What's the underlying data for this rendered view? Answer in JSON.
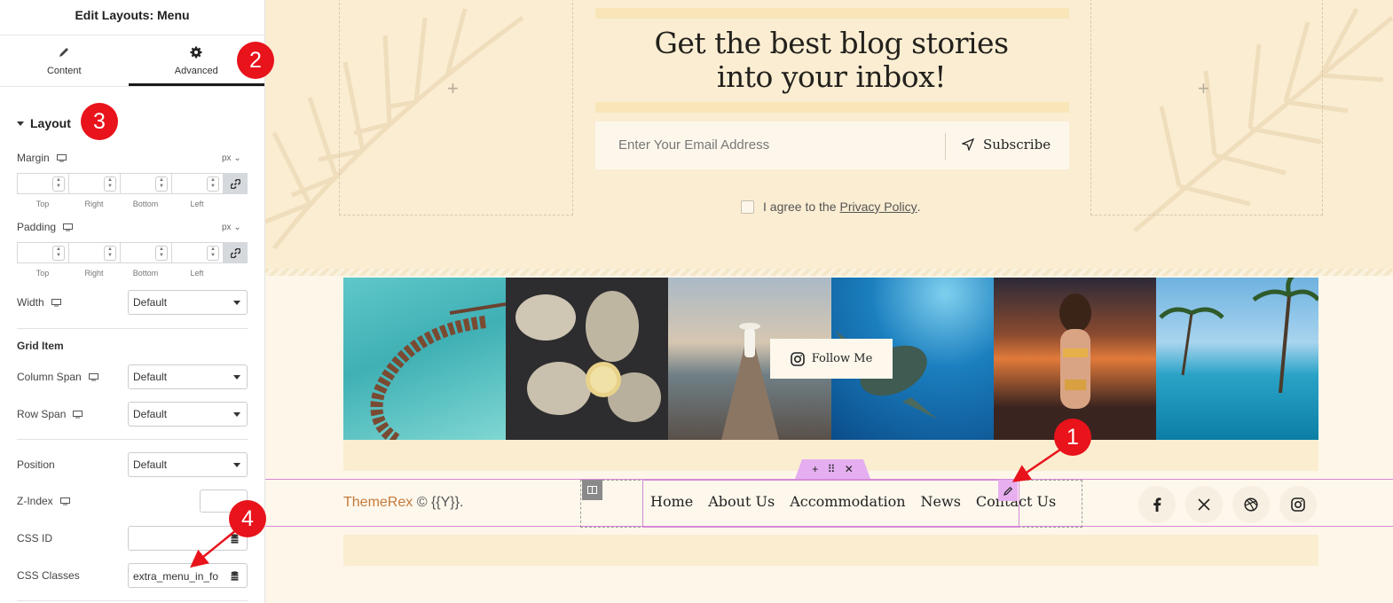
{
  "panel": {
    "title": "Edit Layouts: Menu",
    "tabs": [
      {
        "label": "Content",
        "icon": "pencil-icon"
      },
      {
        "label": "Advanced",
        "icon": "gear-icon"
      }
    ],
    "section_layout": "Layout",
    "margin": {
      "label": "Margin",
      "unit": "px",
      "fields": [
        "Top",
        "Right",
        "Bottom",
        "Left"
      ]
    },
    "padding": {
      "label": "Padding",
      "unit": "px",
      "fields": [
        "Top",
        "Right",
        "Bottom",
        "Left"
      ]
    },
    "width": {
      "label": "Width",
      "value": "Default"
    },
    "grid_item": "Grid Item",
    "column_span": {
      "label": "Column Span",
      "value": "Default"
    },
    "row_span": {
      "label": "Row Span",
      "value": "Default"
    },
    "position": {
      "label": "Position",
      "value": "Default"
    },
    "z_index": {
      "label": "Z-Index",
      "value": ""
    },
    "css_id": {
      "label": "CSS ID",
      "value": ""
    },
    "css_classes": {
      "label": "CSS Classes",
      "value": "extra_menu_in_fo"
    }
  },
  "badges": [
    "1",
    "2",
    "3",
    "4"
  ],
  "newsletter": {
    "title_line1": "Get the best blog stories",
    "title_line2": "into your inbox!",
    "email_placeholder": "Enter Your Email Address",
    "subscribe": "Subscribe",
    "agree_text": "I agree to the",
    "privacy_link": "Privacy Policy",
    "agree_period": "."
  },
  "gallery": {
    "follow_label": "Follow Me",
    "images": [
      "overwater-villas",
      "oysters-lemon",
      "woman-on-pier",
      "sea-turtle",
      "woman-sunset",
      "pool-palms"
    ]
  },
  "footer": {
    "brand": "ThemeRex",
    "copyright": "© {{Y}}.",
    "menu": [
      "Home",
      "About Us",
      "Accommodation",
      "News",
      "Contact Us"
    ],
    "social": [
      "facebook-icon",
      "x-icon",
      "dribbble-icon",
      "instagram-icon"
    ]
  },
  "colors": {
    "badge": "#e8131b",
    "brand": "#c57b3c",
    "selection": "#d68ad8",
    "canvas_bg": "#faedd2"
  }
}
